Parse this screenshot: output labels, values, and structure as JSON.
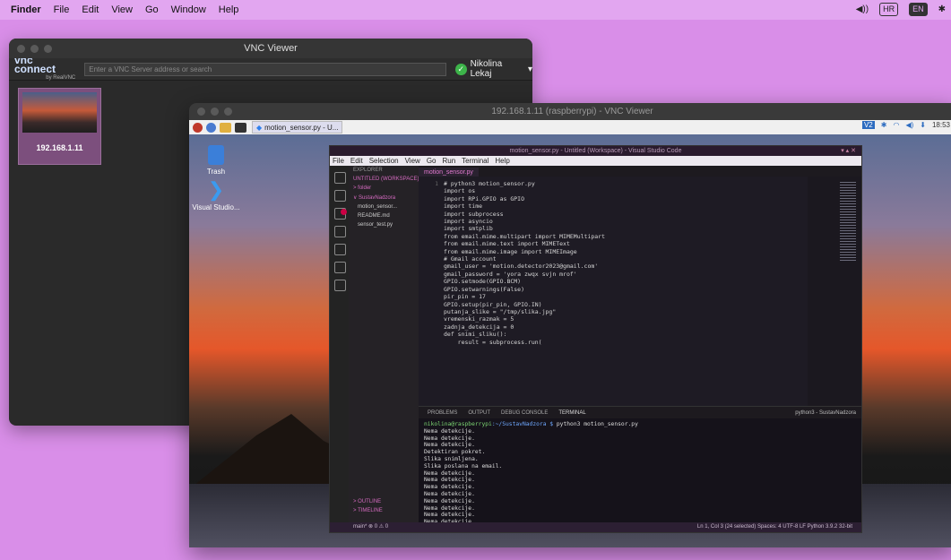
{
  "menubar": {
    "items": [
      "Finder",
      "File",
      "Edit",
      "View",
      "Go",
      "Window",
      "Help"
    ],
    "input_badge": "HR",
    "right_badge": "EN"
  },
  "vnc_viewer": {
    "title": "VNC Viewer",
    "logo": "vnc connect",
    "logo_sub": "by RealVNC",
    "search_placeholder": "Enter a VNC Server address or search",
    "user": "Nikolina Lekaj",
    "thumbnail_label": "192.168.1.11"
  },
  "pi_window": {
    "title": "192.168.1.11 (raspberrypi) - VNC Viewer",
    "taskbar_item": "motion_sensor.py - U...",
    "clock": "18:53",
    "desktop_icons": [
      {
        "label": "Trash"
      },
      {
        "label": "Visual Studio..."
      }
    ]
  },
  "vscode": {
    "title": "motion_sensor.py - Untitled (Workspace) - Visual Studio Code",
    "menu": [
      "File",
      "Edit",
      "Selection",
      "View",
      "Go",
      "Run",
      "Terminal",
      "Help"
    ],
    "explorer": {
      "header": "EXPLORER",
      "workspace": "UNTITLED (WORKSPACE)",
      "items": [
        "> folder",
        "∨ SustavNadzora",
        "motion_sensor...",
        "README.md",
        "sensor_test.py"
      ],
      "outline": "> OUTLINE",
      "timeline": "> TIMELINE"
    },
    "active_tab": "motion_sensor.py",
    "code_lines": [
      {
        "n": "1",
        "t": "# python3 motion_sensor.py"
      },
      {
        "n": "",
        "t": ""
      },
      {
        "n": "",
        "t": "import os"
      },
      {
        "n": "",
        "t": "import RPi.GPIO as GPIO"
      },
      {
        "n": "",
        "t": "import time"
      },
      {
        "n": "",
        "t": "import subprocess"
      },
      {
        "n": "",
        "t": "import asyncio"
      },
      {
        "n": "",
        "t": "import smtplib"
      },
      {
        "n": "",
        "t": ""
      },
      {
        "n": "",
        "t": "from email.mime.multipart import MIMEMultipart"
      },
      {
        "n": "",
        "t": "from email.mime.text import MIMEText"
      },
      {
        "n": "",
        "t": "from email.mime.image import MIMEImage"
      },
      {
        "n": "",
        "t": ""
      },
      {
        "n": "",
        "t": ""
      },
      {
        "n": "",
        "t": "# Gmail account"
      },
      {
        "n": "",
        "t": "gmail_user = 'motion.detector2023@gmail.com'"
      },
      {
        "n": "",
        "t": "gmail_password = 'yora zwqx svjn mrof'"
      },
      {
        "n": "",
        "t": ""
      },
      {
        "n": "",
        "t": "GPIO.setmode(GPIO.BCM)"
      },
      {
        "n": "",
        "t": "GPIO.setwarnings(False)"
      },
      {
        "n": "",
        "t": "pir_pin = 17"
      },
      {
        "n": "",
        "t": "GPIO.setup(pir_pin, GPIO.IN)"
      },
      {
        "n": "",
        "t": ""
      },
      {
        "n": "",
        "t": "putanja_slike = \"/tmp/slika.jpg\""
      },
      {
        "n": "",
        "t": "vremenski_razmak = 5"
      },
      {
        "n": "",
        "t": "zadnja_detekcija = 0"
      },
      {
        "n": "",
        "t": ""
      },
      {
        "n": "",
        "t": "def snimi_sliku():"
      },
      {
        "n": "",
        "t": "    result = subprocess.run("
      }
    ],
    "panel_tabs": [
      "PROBLEMS",
      "OUTPUT",
      "DEBUG CONSOLE",
      "TERMINAL"
    ],
    "panel_right": "python3 - SustavNadzora",
    "terminal": {
      "prompt_user": "nikolina@raspberrypi",
      "prompt_path": ":~/SustavNadzora $",
      "command": " python3 motion_sensor.py",
      "lines": [
        "Nema detekcije.",
        "Nema detekcije.",
        "Nema detekcije.",
        "Detektiran pokret.",
        "Slika snimljena.",
        "Slika poslana na email.",
        "Nema detekcije.",
        "Nema detekcije.",
        "Nema detekcije.",
        "Nema detekcije.",
        "Nema detekcije.",
        "Nema detekcije.",
        "Nema detekcije.",
        "Nema detekcije."
      ]
    },
    "status_left": "main*  ⊗ 0 ⚠ 0",
    "status_right": "Ln 1, Col 3 (24 selected)   Spaces: 4   UTF-8   LF   Python   3.9.2 32-bit"
  }
}
